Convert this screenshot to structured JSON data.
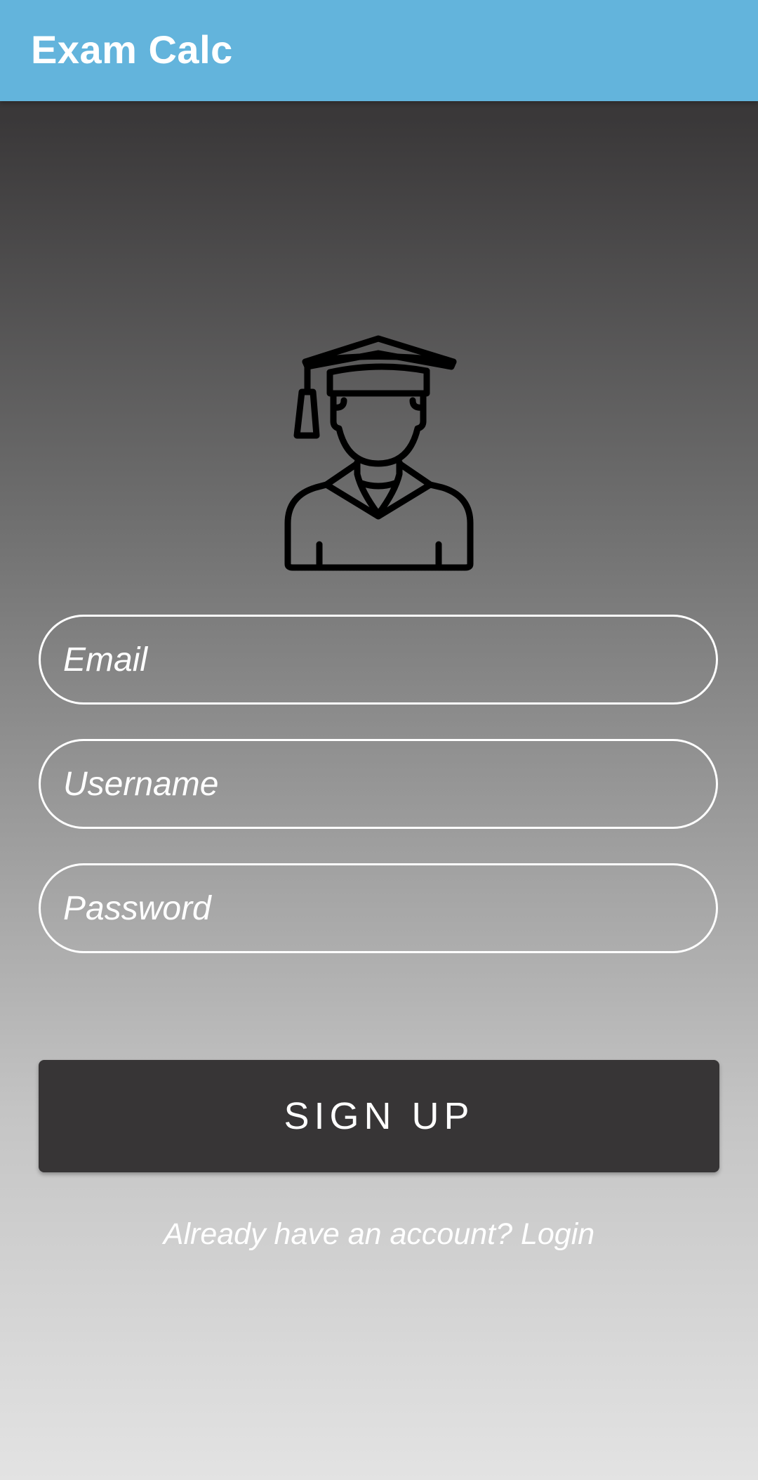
{
  "app": {
    "title": "Exam Calc"
  },
  "avatar": {
    "icon": "graduate-student-icon"
  },
  "form": {
    "email_placeholder": "Email",
    "username_placeholder": "Username",
    "password_placeholder": "Password",
    "signup_label": "SIGN UP",
    "login_prompt": "Already have an account? Login"
  },
  "colors": {
    "appbar": "#63b4dc",
    "button": "#373536",
    "text": "#ffffff"
  }
}
